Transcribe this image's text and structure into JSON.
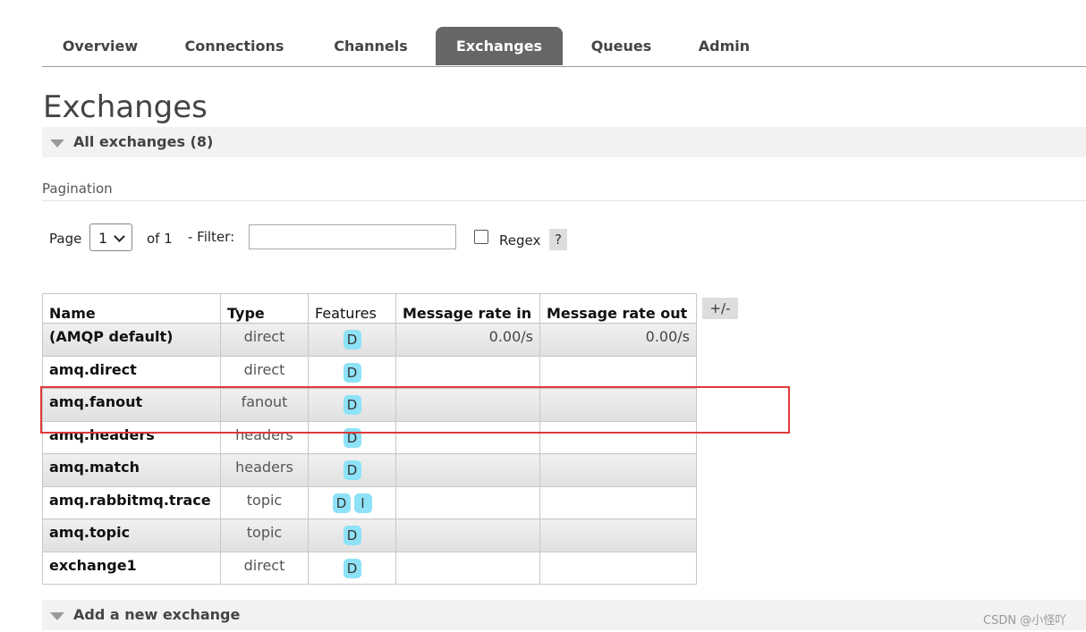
{
  "nav": {
    "tabs": [
      {
        "label": "Overview",
        "active": false
      },
      {
        "label": "Connections",
        "active": false
      },
      {
        "label": "Channels",
        "active": false
      },
      {
        "label": "Exchanges",
        "active": true
      },
      {
        "label": "Queues",
        "active": false
      },
      {
        "label": "Admin",
        "active": false
      }
    ]
  },
  "page": {
    "title": "Exchanges"
  },
  "all_exchanges": {
    "label": "All exchanges (8)"
  },
  "pagination": {
    "heading": "Pagination",
    "page_label": "Page",
    "page_value": "1",
    "of_label": "of 1",
    "filter_label": "- Filter:",
    "filter_value": "",
    "regex_label": "Regex",
    "regex_checked": false,
    "help_label": "?"
  },
  "table": {
    "headers": {
      "name": "Name",
      "type": "Type",
      "features": "Features",
      "rate_in": "Message rate in",
      "rate_out": "Message rate out"
    },
    "column_toggle": "+/-",
    "rows": [
      {
        "name": "(AMQP default)",
        "type": "direct",
        "features": [
          "D"
        ],
        "rate_in": "0.00/s",
        "rate_out": "0.00/s"
      },
      {
        "name": "amq.direct",
        "type": "direct",
        "features": [
          "D"
        ],
        "rate_in": "",
        "rate_out": ""
      },
      {
        "name": "amq.fanout",
        "type": "fanout",
        "features": [
          "D"
        ],
        "rate_in": "",
        "rate_out": ""
      },
      {
        "name": "amq.headers",
        "type": "headers",
        "features": [
          "D"
        ],
        "rate_in": "",
        "rate_out": ""
      },
      {
        "name": "amq.match",
        "type": "headers",
        "features": [
          "D"
        ],
        "rate_in": "",
        "rate_out": ""
      },
      {
        "name": "amq.rabbitmq.trace",
        "type": "topic",
        "features": [
          "D",
          "I"
        ],
        "rate_in": "",
        "rate_out": ""
      },
      {
        "name": "amq.topic",
        "type": "topic",
        "features": [
          "D"
        ],
        "rate_in": "",
        "rate_out": ""
      },
      {
        "name": "exchange1",
        "type": "direct",
        "features": [
          "D"
        ],
        "rate_in": "",
        "rate_out": ""
      }
    ]
  },
  "add_exchange": {
    "label": "Add a new exchange"
  },
  "watermark": "CSDN @小怪吖",
  "colors": {
    "active_tab": "#666666",
    "badge": "#8ee2f7",
    "highlight": "#e03a3a"
  }
}
